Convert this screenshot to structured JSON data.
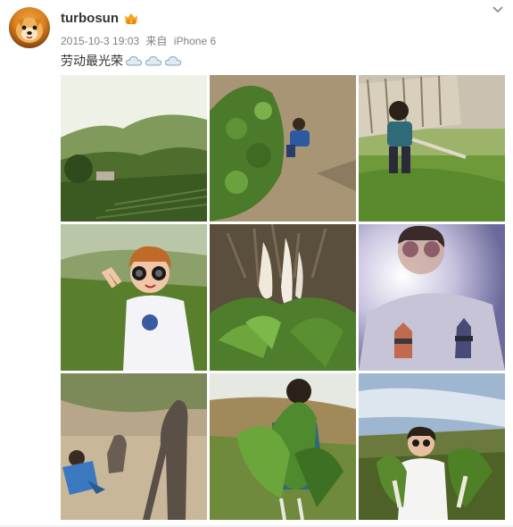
{
  "post": {
    "username": "turbosun",
    "time": "2015-10-3 19:03",
    "source_prefix": "来自",
    "source": "iPhone 6",
    "caption": "劳动最光荣"
  },
  "icons": {
    "avatar": "dog-avatar-icon",
    "badge": "vip-badge-icon",
    "caption_emoji": [
      "cloud-emoji-icon",
      "cloud-emoji-icon",
      "cloud-emoji-icon"
    ],
    "menu": "chevron-down-icon"
  },
  "colors": {
    "username": "#333333",
    "meta": "#808080",
    "badge": "#f5a623"
  },
  "photos": [
    {
      "name": "mountain-field-photo"
    },
    {
      "name": "child-in-garden-photo"
    },
    {
      "name": "child-with-hoe-photo"
    },
    {
      "name": "selfie-sunglasses-photo"
    },
    {
      "name": "harvested-radish-photo"
    },
    {
      "name": "tshirt-selfie-photo"
    },
    {
      "name": "shadow-on-ground-photo"
    },
    {
      "name": "holding-greens-photo"
    },
    {
      "name": "holding-radishes-photo"
    }
  ]
}
